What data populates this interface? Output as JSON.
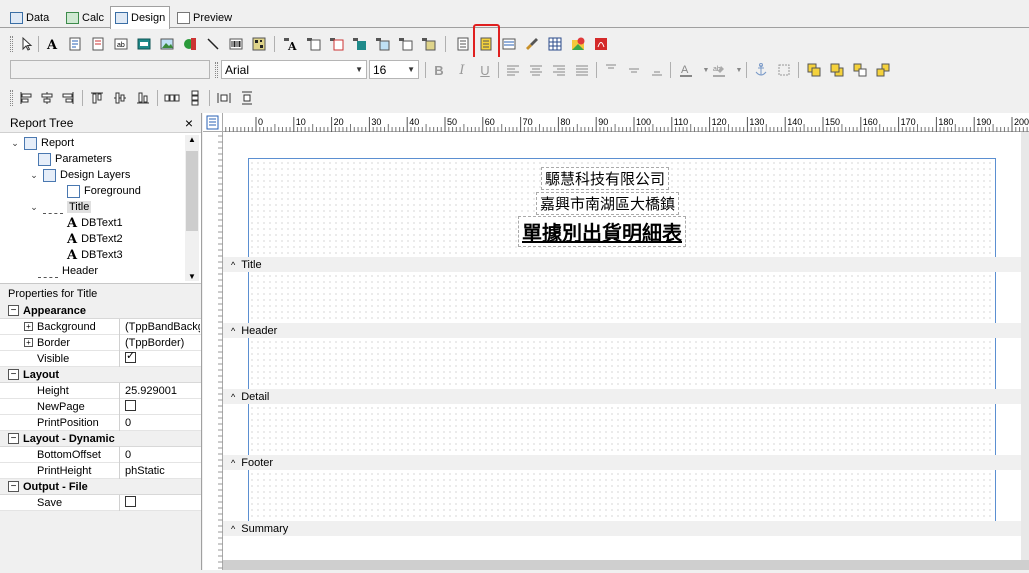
{
  "tabs": [
    {
      "label": "Data",
      "active": false
    },
    {
      "label": "Calc",
      "active": false
    },
    {
      "label": "Design",
      "active": true
    },
    {
      "label": "Preview",
      "active": false
    }
  ],
  "format_bar": {
    "font_name": "Arial",
    "font_size": "16"
  },
  "report_tree": {
    "title": "Report Tree",
    "close": "×",
    "nodes": [
      {
        "label": "Report"
      },
      {
        "label": "Parameters"
      },
      {
        "label": "Design Layers"
      },
      {
        "label": "Foreground"
      },
      {
        "label": "Title"
      },
      {
        "label": "DBText1"
      },
      {
        "label": "DBText2"
      },
      {
        "label": "DBText3"
      },
      {
        "label": "Header"
      }
    ]
  },
  "properties": {
    "title": "Properties for Title",
    "categories": [
      {
        "name": "Appearance",
        "rows": [
          {
            "name": "Background",
            "value": "(TppBandBackground)",
            "expandable": true
          },
          {
            "name": "Border",
            "value": "(TppBorder)",
            "expandable": true
          },
          {
            "name": "Visible",
            "value": "",
            "checkbox": true,
            "checked": true
          }
        ]
      },
      {
        "name": "Layout",
        "rows": [
          {
            "name": "Height",
            "value": "25.929001"
          },
          {
            "name": "NewPage",
            "value": "",
            "checkbox": true,
            "checked": false
          },
          {
            "name": "PrintPosition",
            "value": "0"
          }
        ]
      },
      {
        "name": "Layout - Dynamic",
        "rows": [
          {
            "name": "BottomOffset",
            "value": "0"
          },
          {
            "name": "PrintHeight",
            "value": "phStatic"
          }
        ]
      },
      {
        "name": "Output - File",
        "rows": [
          {
            "name": "Save",
            "value": "",
            "checkbox": true,
            "checked": false
          }
        ]
      }
    ]
  },
  "ruler": {
    "ticks": [
      "0",
      "10",
      "20",
      "30",
      "40",
      "50",
      "60",
      "70",
      "80",
      "90",
      "100",
      "110",
      "120",
      "130",
      "140",
      "150",
      "160",
      "170",
      "180",
      "190",
      "200"
    ]
  },
  "design": {
    "company": "騵慧科技有限公司",
    "address": "嘉興市南湖區大橋鎮",
    "report_title": "單據別出貨明細表",
    "bands": [
      {
        "label": "Title"
      },
      {
        "label": "Header"
      },
      {
        "label": "Detail"
      },
      {
        "label": "Footer"
      },
      {
        "label": "Summary"
      }
    ]
  },
  "colors": {
    "highlight": "#e02020",
    "margin": "#5b8fd1"
  }
}
